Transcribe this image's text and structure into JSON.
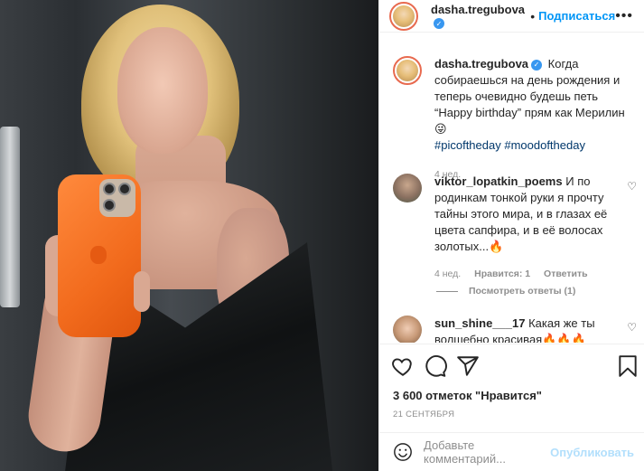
{
  "post": {
    "username": "dasha.tregubova",
    "follow_label": "Подписаться",
    "separator": "•",
    "more_label": "•••"
  },
  "caption": {
    "username": "dasha.tregubova",
    "text": "Когда собираешься на день рождения и теперь очевидно будешь петь “Happy birthday” прям как Мерилин😜",
    "hashtags": "#picoftheday #moodoftheday",
    "time": "4 нед."
  },
  "comments": [
    {
      "username": "viktor_lopatkin_poems",
      "text": "И по родинкам тонкой руки я прочту тайны этого мира, и в глазах её цвета сапфира, и в её волосах золотых...🔥",
      "time": "4 нед.",
      "likes": "Нравится: 1",
      "reply": "Ответить",
      "view_replies": "Посмотреть ответы (1)"
    },
    {
      "username": "sun_shine___17",
      "text": "Какая же ты волшебно красивая🔥🔥🔥"
    }
  ],
  "likes_text": "3 600 отметок \"Нравится\"",
  "date_text": "21 СЕНТЯБРЯ",
  "add_comment": {
    "placeholder": "Добавьте комментарий...",
    "publish_label": "Опубликовать"
  },
  "colors": {
    "accent": "#0095f6",
    "publish_disabled": "#b2dffc",
    "verified": "#3897f0",
    "phone_case": "#f26b1d"
  },
  "icons": [
    "heart-icon",
    "comment-icon",
    "share-icon",
    "bookmark-icon",
    "emoji-icon",
    "verified-badge-icon",
    "more-icon"
  ]
}
